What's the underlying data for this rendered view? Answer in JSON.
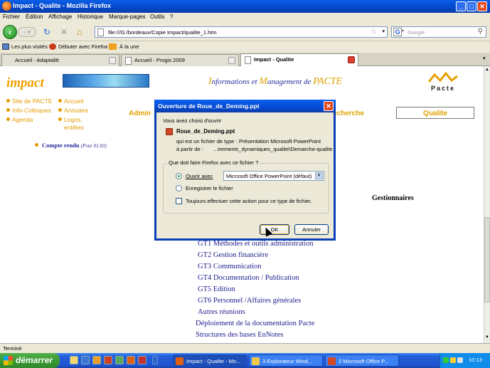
{
  "window": {
    "title": "Impact - Qualite - Mozilla Firefox"
  },
  "menu": [
    "Fichier",
    "Édition",
    "Affichage",
    "Historique",
    "Marque-pages",
    "Outils",
    "?"
  ],
  "navbar": {
    "url": "file:///G:/bordeaux/Copie Impact/qualite_1.htm",
    "search_placeholder": "Google",
    "search_engine_letter": "G"
  },
  "bookmarks": [
    "Les plus visités",
    "Débuter avec Firefox",
    "À la une"
  ],
  "tabs": [
    {
      "label": "Accueil - Adaptalitt",
      "active": false
    },
    {
      "label": "Accueil - Progis 2009",
      "active": false
    },
    {
      "label": "Impact - Qualite",
      "active": true
    }
  ],
  "page": {
    "logo": "impact",
    "tagline": {
      "w1_cap": "I",
      "w1": "nformations et ",
      "w2_cap": "M",
      "w2": "anagement de ",
      "w3_cap": "PACTE"
    },
    "pacte_logo": "Pacte",
    "left_nav": [
      "Site de PACTE",
      "Info-Colloques",
      "Agenda"
    ],
    "right_nav": [
      "Accueil",
      "Annuaire",
      "Logos,",
      "entêtes"
    ],
    "admin_label": "Admin",
    "recherche_label": "echerche",
    "qualite_label": "Qualite",
    "compte_rendu": "Compte rendu",
    "compte_rendu_note": "(Pour 01.03)",
    "gestionnaires": "Gestionnaires",
    "links": [
      "GT1 Méthodes et outils administration",
      "GT2 Gestion financière",
      "GT3 Communication",
      "GT4 Documentation / Publication",
      "GT5 Edition",
      "GT6 Personnel /Affaires générales",
      "Autres réunions",
      "Déploiement de la documentation Pacte",
      "Structures des bases EnNotes"
    ]
  },
  "dialog": {
    "title": "Ouverture de Roue_de_Deming.ppt",
    "intro": "Vous avez choisi d'ouvrir",
    "filename": "Roue_de_Deming.ppt",
    "type_label": "qui est un fichier de type :",
    "type_value": "Présentation Microsoft PowerPoint",
    "from_label": "à partir de :",
    "from_value": "...trements_dynamiques_qualite\\Demarche-qualite",
    "question": "Que doit faire Firefox avec ce fichier ?",
    "open_with_label": "Ouvrir avec",
    "open_with_app": "Microsoft Office PowerPoint (défaut)",
    "save_label": "Enregistrer le fichier",
    "always_label": "Toujours effectuer cette action pour ce type de fichier.",
    "ok": "OK",
    "cancel": "Annuler"
  },
  "status": "Terminé",
  "taskbar": {
    "start": "démarrer",
    "tasks": [
      "Impact - Qualite - Mo...",
      "3 Explorateur Wind...",
      "2 Microsoft Office P..."
    ],
    "clock": "10:13"
  }
}
